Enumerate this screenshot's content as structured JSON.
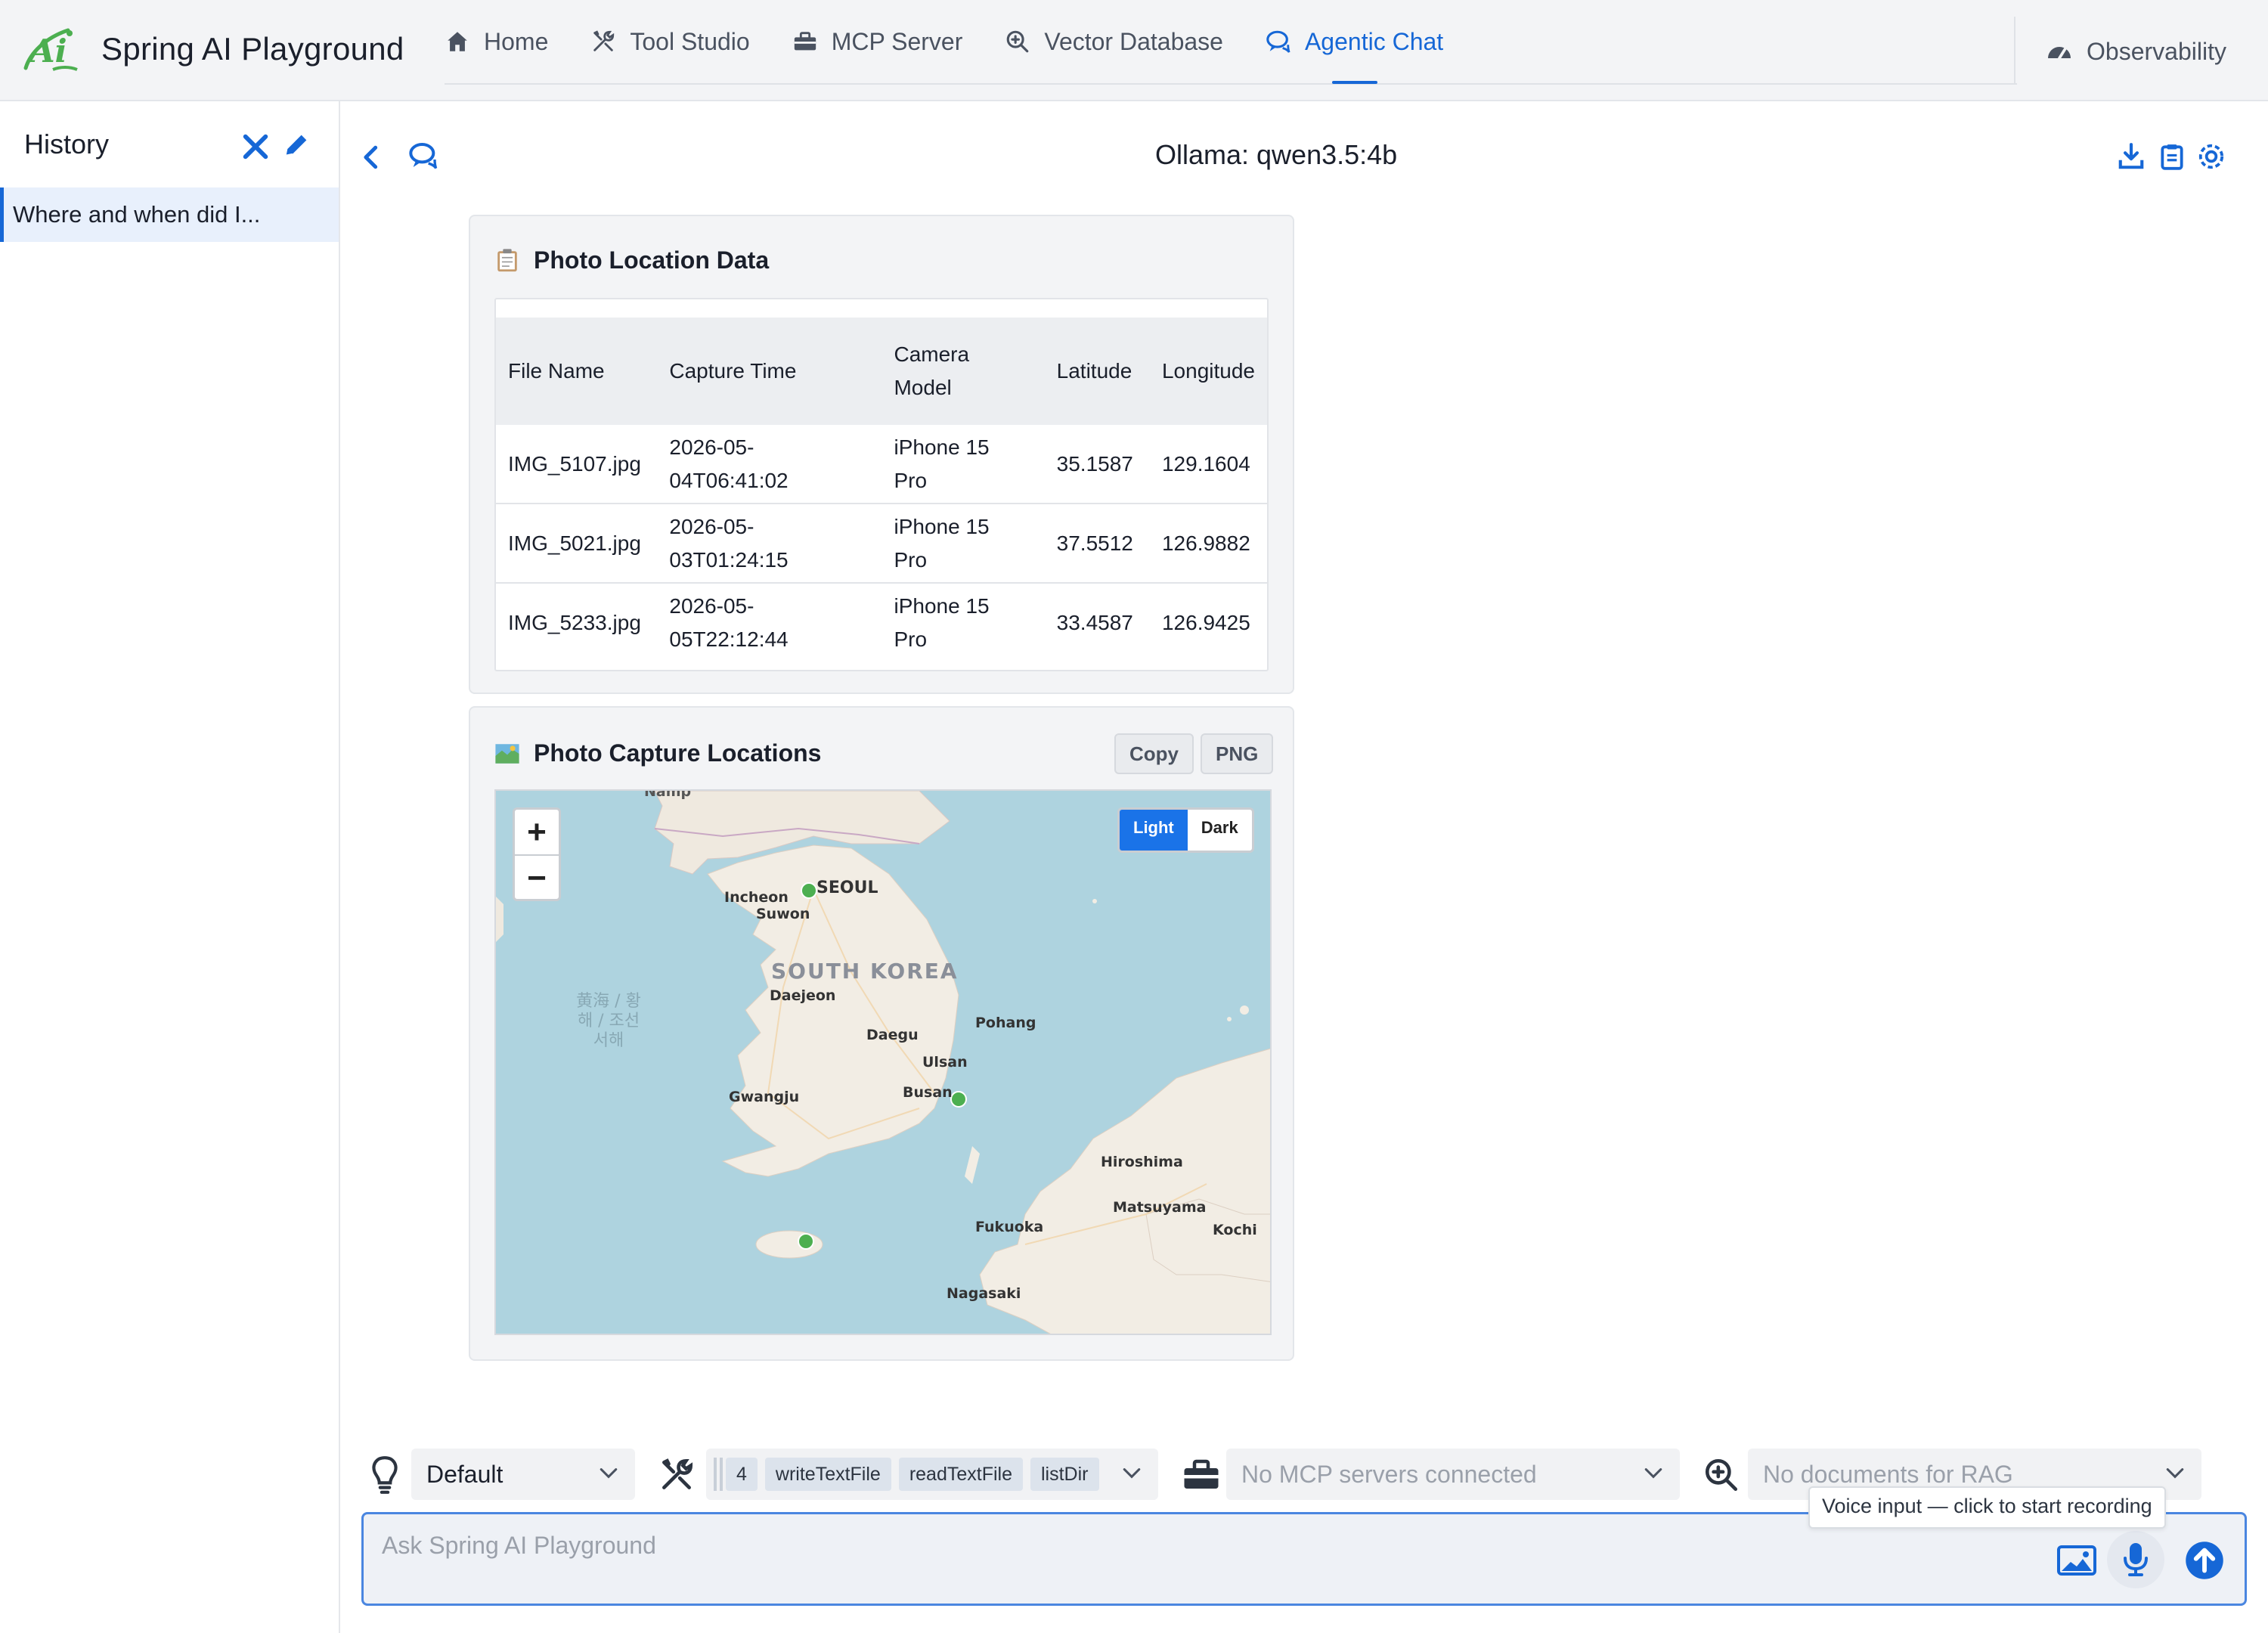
{
  "app": {
    "title": "Spring AI Playground"
  },
  "nav": {
    "tabs": [
      {
        "label": "Home",
        "icon": "home-icon"
      },
      {
        "label": "Tool Studio",
        "icon": "tools-icon"
      },
      {
        "label": "MCP Server",
        "icon": "toolbox-icon"
      },
      {
        "label": "Vector Database",
        "icon": "search-plus-icon"
      },
      {
        "label": "Agentic Chat",
        "icon": "chat-icon",
        "active": true
      }
    ],
    "observability": "Observability"
  },
  "sidebar": {
    "title": "History",
    "items": [
      {
        "label": "Where and when did I..."
      }
    ]
  },
  "chat": {
    "model": "Ollama: qwen3.5:4b"
  },
  "table_card": {
    "title": "Photo Location Data",
    "columns": [
      "File Name",
      "Capture Time",
      "Camera Model",
      "Latitude",
      "Longitude"
    ],
    "rows": [
      {
        "file": "IMG_5107.jpg",
        "time": "2026-05-04T06:41:02",
        "camera": "iPhone 15 Pro",
        "lat": "35.1587",
        "lon": "129.1604"
      },
      {
        "file": "IMG_5021.jpg",
        "time": "2026-05-03T01:24:15",
        "camera": "iPhone 15 Pro",
        "lat": "37.5512",
        "lon": "126.9882"
      },
      {
        "file": "IMG_5233.jpg",
        "time": "2026-05-05T22:12:44",
        "camera": "iPhone 15 Pro",
        "lat": "33.4587",
        "lon": "126.9425"
      }
    ]
  },
  "map_card": {
    "title": "Photo Capture Locations",
    "copy_label": "Copy",
    "png_label": "PNG",
    "zoom_in": "+",
    "zoom_out": "−",
    "theme_light": "Light",
    "theme_dark": "Dark",
    "country_label": "SOUTH KOREA",
    "sea_label": "黄海 / 황\n해 / 조선\n서해",
    "cities": [
      "SEOUL",
      "Incheon",
      "Suwon",
      "Daejeon",
      "Daegu",
      "Pohang",
      "Ulsan",
      "Busan",
      "Gwangju",
      "Hiroshima",
      "Matsuyama",
      "Fukuoka",
      "Kochi",
      "Nagasaki"
    ],
    "top_label": "Namp",
    "marker_color": "#4caf50"
  },
  "controls": {
    "persona": "Default",
    "tool_count": "4",
    "tools": [
      "writeTextFile",
      "readTextFile",
      "listDir"
    ],
    "mcp_placeholder": "No MCP servers connected",
    "rag_placeholder": "No documents for RAG",
    "input_placeholder": "Ask Spring AI Playground",
    "voice_tooltip": "Voice input — click to start recording"
  },
  "colors": {
    "accent": "#1667d6",
    "logo_green": "#4caf50"
  }
}
